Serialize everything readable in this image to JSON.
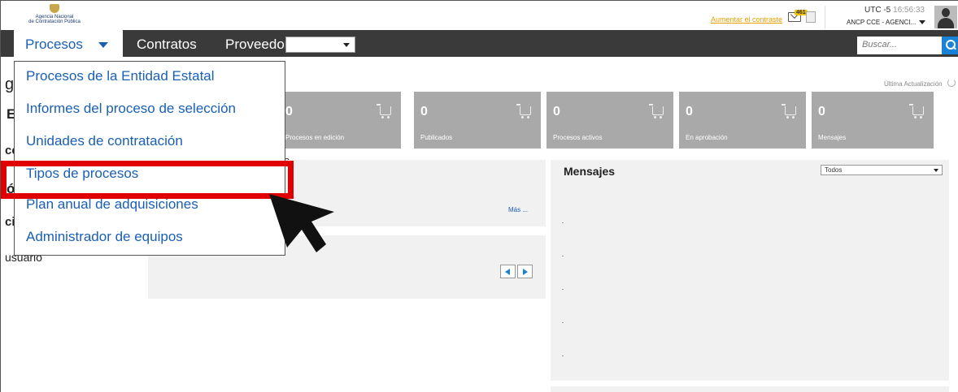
{
  "header": {
    "logo_line1": "Agencia Nacional",
    "logo_line2": "de Contratación Pública",
    "contrast_link": "Aumentar el contraste",
    "mail_count": "461",
    "clock_tz": "UTC -5",
    "clock_time": "16:56:33",
    "org_name": "ANCP CCE - AGENCI..."
  },
  "nav": {
    "active_label": "Procesos",
    "items": [
      "Contratos",
      "Proveedor"
    ],
    "search_placeholder": "Buscar..."
  },
  "dropdown": {
    "items": [
      "Procesos de la Entidad Estatal",
      "Informes del proceso de selección",
      "Unidades de contratación",
      "Tipos de procesos",
      "Plan anual de adquisiciones",
      "Administrador de equipos"
    ],
    "highlighted_index": 3
  },
  "partial_text": {
    "g": "g",
    "e": "E",
    "ce": "ce",
    "o": "ó",
    "ci": "ci",
    "usuario": "usuario",
    "o2": "o"
  },
  "stats": {
    "last_update_label": "Última Actualización",
    "tiles": [
      {
        "value": "0",
        "label": "Procesos en edición"
      },
      {
        "value": "0",
        "label": "Publicados"
      },
      {
        "value": "0",
        "label": "Procesos activos"
      },
      {
        "value": "0",
        "label": "En aprobación"
      },
      {
        "value": "0",
        "label": "Mensajes"
      }
    ]
  },
  "panels": {
    "more_link": "Más ...",
    "messages_title": "Mensajes",
    "messages_filter": "Todos"
  },
  "colors": {
    "nav_bg": "#3a3a3a",
    "link_blue": "#1a5fb4",
    "highlight_red": "#e10000",
    "tile_gray": "#a9a9a9",
    "accent_orange": "#e6a100"
  }
}
